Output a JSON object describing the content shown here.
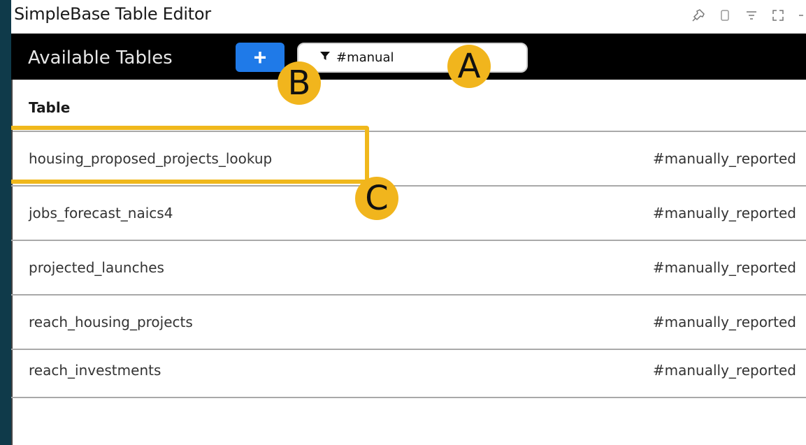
{
  "window": {
    "title": "SimpleBase Table Editor"
  },
  "title_icons": [
    "pin-icon",
    "copy-icon",
    "filter-lines-icon",
    "expand-icon",
    "more-icon"
  ],
  "header": {
    "title": "Available Tables",
    "add_label": "+"
  },
  "filter": {
    "value": "#manual",
    "icon": "funnel-icon"
  },
  "table": {
    "column_header": "Table",
    "rows": [
      {
        "name": "housing_proposed_projects_lookup",
        "tag": "#manually_reported"
      },
      {
        "name": "jobs_forecast_naics4",
        "tag": "#manually_reported"
      },
      {
        "name": "projected_launches",
        "tag": "#manually_reported"
      },
      {
        "name": "reach_housing_projects",
        "tag": "#manually_reported"
      },
      {
        "name": "reach_investments",
        "tag": "#manually_reported"
      }
    ]
  },
  "annotations": {
    "a": "A",
    "b": "B",
    "c": "C",
    "color": "#f1b51d"
  },
  "colors": {
    "background": "#0f3a4a",
    "header": "#000000",
    "accent": "#1f7ae8"
  }
}
